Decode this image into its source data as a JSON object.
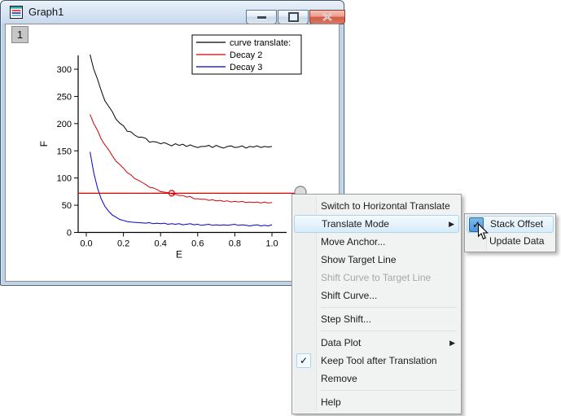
{
  "window": {
    "title": "Graph1",
    "layer_badge": "1"
  },
  "glyphs": {
    "submenu_arrow": "▶",
    "check": "✓"
  },
  "chart_data": {
    "type": "line",
    "title": "",
    "xlabel": "E",
    "ylabel": "F",
    "xlim": [
      -0.04,
      1.08
    ],
    "ylim": [
      0,
      325
    ],
    "x_ticks": [
      0.0,
      0.2,
      0.4,
      0.6,
      0.8,
      1.0
    ],
    "x_tick_labels": [
      "0.0",
      "0.2",
      "0.4",
      "0.6",
      "0.8",
      "1.0"
    ],
    "y_ticks": [
      0,
      50,
      100,
      150,
      200,
      250,
      300
    ],
    "grid": false,
    "legend": {
      "position": "top-right",
      "entries": [
        "curve translate:",
        "Decay 2",
        "Decay 3"
      ]
    },
    "x_start": 0.02,
    "x_step": 0.02,
    "series": [
      {
        "name": "curve translate:",
        "color": "#000000",
        "values": [
          327,
          300,
          282,
          261,
          242,
          232,
          222,
          208,
          201,
          196,
          186,
          185,
          179,
          175,
          175,
          173,
          166,
          167,
          166,
          163,
          165,
          162,
          159,
          163,
          160,
          162,
          158,
          161,
          158,
          156,
          158,
          158,
          160,
          156,
          160,
          157,
          155,
          158,
          159,
          156,
          157,
          159,
          155,
          158,
          157,
          159,
          156,
          158,
          157,
          158
        ]
      },
      {
        "name": "Decay 2",
        "color": "#d40000",
        "values": [
          217,
          200,
          188,
          172,
          161,
          152,
          141,
          131,
          125,
          118,
          110,
          106,
          99,
          96,
          92,
          88,
          83,
          82,
          79,
          75,
          74,
          73,
          71,
          70,
          68,
          68,
          65,
          66,
          62,
          62,
          61,
          61,
          59,
          60,
          58,
          59,
          57,
          58,
          56,
          57,
          56,
          57,
          55,
          56,
          55,
          56,
          54,
          56,
          54,
          55
        ]
      },
      {
        "name": "Decay 3",
        "color": "#0000c8",
        "values": [
          148,
          110,
          82,
          62,
          48,
          39,
          32,
          28,
          24,
          22,
          20,
          19,
          18.5,
          18,
          17.5,
          17,
          18,
          16,
          17,
          16,
          17,
          15,
          16,
          15,
          16,
          14,
          15,
          16,
          14,
          15,
          13,
          14,
          15,
          13,
          14,
          13,
          14,
          13,
          14,
          15,
          13,
          14,
          13,
          12,
          13,
          14,
          12,
          13,
          12,
          14
        ]
      }
    ],
    "target_line": {
      "y": 72,
      "color": "#e10000",
      "anchor_x": 0.46
    }
  },
  "context_menu": {
    "items": [
      {
        "label": "Switch to Horizontal Translate"
      },
      {
        "label": "Translate Mode",
        "submenu": true,
        "highlighted": true
      },
      {
        "label": "Move Anchor..."
      },
      {
        "label": "Show Target Line"
      },
      {
        "label": "Shift Curve to Target Line",
        "disabled": true
      },
      {
        "label": "Shift Curve..."
      },
      {
        "separator": true
      },
      {
        "label": "Step Shift..."
      },
      {
        "separator": true
      },
      {
        "label": "Data Plot",
        "submenu": true
      },
      {
        "label": "Keep Tool after Translation",
        "checked": true
      },
      {
        "label": "Remove"
      },
      {
        "separator": true
      },
      {
        "label": "Help"
      }
    ]
  },
  "submenu": {
    "items": [
      {
        "label": "Stack Offset",
        "checked": true,
        "highlighted": true
      },
      {
        "label": "Update Data"
      }
    ]
  }
}
